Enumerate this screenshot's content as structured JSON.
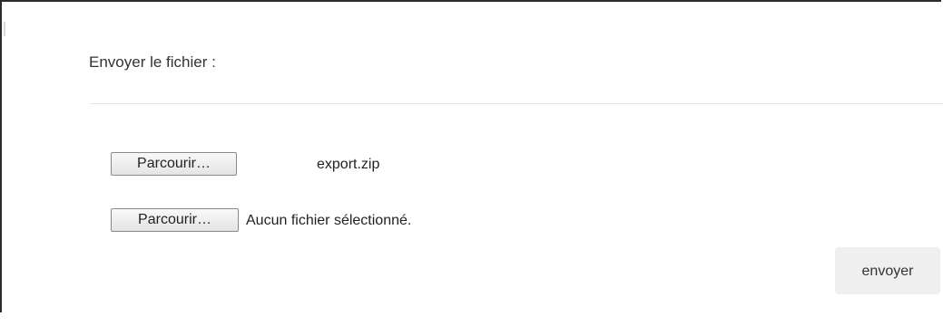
{
  "panel": {
    "title": "Envoyer le fichier :"
  },
  "uploads": [
    {
      "browse_label": "Parcourir…",
      "file_status": "export.zip"
    },
    {
      "browse_label": "Parcourir…",
      "file_status": "Aucun fichier sélectionné."
    }
  ],
  "actions": {
    "submit_label": "envoyer"
  },
  "colors": {
    "frame_border": "#2b2b2b",
    "divider": "#e6e6e6",
    "submit_background": "#efefef",
    "text": "#333333"
  }
}
